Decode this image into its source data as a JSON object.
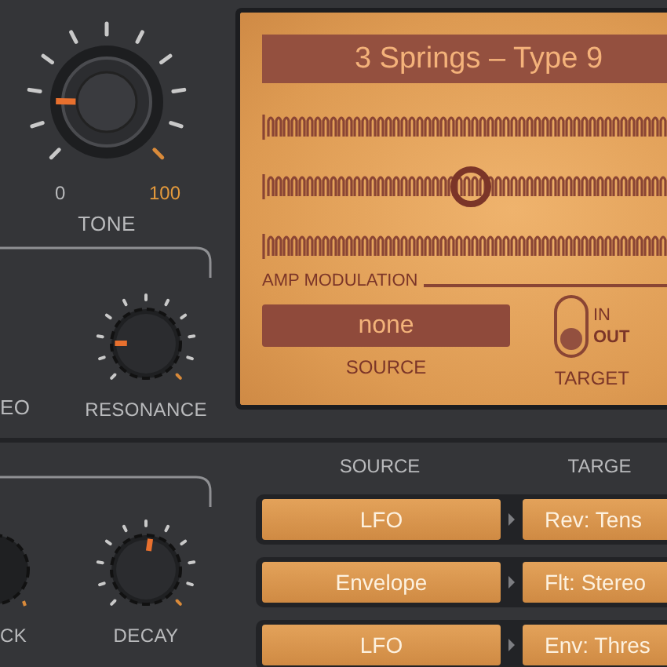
{
  "tone_knob": {
    "label": "TONE",
    "min_label": "0",
    "max_label": "100",
    "level": 0.17
  },
  "filter_section": {
    "cut_label": "EO",
    "knob": {
      "label": "RESONANCE",
      "level": 0.17
    }
  },
  "envelope_section": {
    "cut_label": "CK",
    "knob": {
      "label": "DECAY",
      "level": 0.53
    }
  },
  "display": {
    "preset": "3 Springs – Type 9",
    "amp_modulation": {
      "title": "AMP MODULATION",
      "source_value": "none",
      "source_label": "SOURCE",
      "target_label": "TARGET",
      "switch": {
        "on_label": "IN",
        "off_label": "OUT",
        "on": false
      }
    }
  },
  "mod_matrix": {
    "columns": [
      "SOURCE",
      "TARGE"
    ],
    "rows": [
      {
        "source": "LFO",
        "target": "Rev: Tens"
      },
      {
        "source": "Envelope",
        "target": "Flt: Stereo"
      },
      {
        "source": "LFO",
        "target": "Env: Thres"
      }
    ]
  }
}
